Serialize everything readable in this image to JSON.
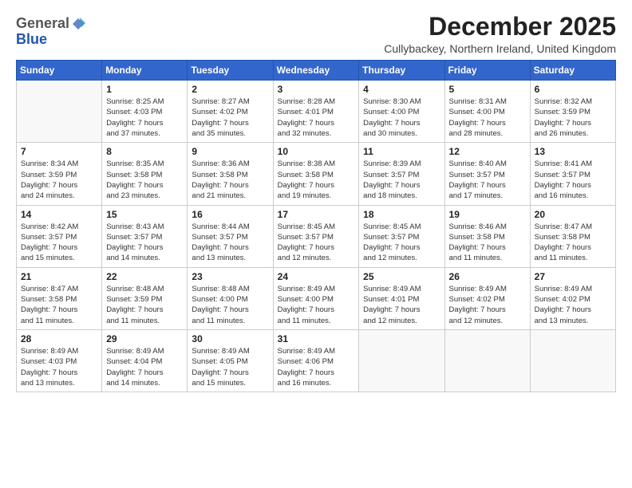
{
  "logo": {
    "general": "General",
    "blue": "Blue"
  },
  "title": "December 2025",
  "location": "Cullybackey, Northern Ireland, United Kingdom",
  "weekdays": [
    "Sunday",
    "Monday",
    "Tuesday",
    "Wednesday",
    "Thursday",
    "Friday",
    "Saturday"
  ],
  "weeks": [
    [
      {
        "day": "",
        "info": ""
      },
      {
        "day": "1",
        "info": "Sunrise: 8:25 AM\nSunset: 4:03 PM\nDaylight: 7 hours\nand 37 minutes."
      },
      {
        "day": "2",
        "info": "Sunrise: 8:27 AM\nSunset: 4:02 PM\nDaylight: 7 hours\nand 35 minutes."
      },
      {
        "day": "3",
        "info": "Sunrise: 8:28 AM\nSunset: 4:01 PM\nDaylight: 7 hours\nand 32 minutes."
      },
      {
        "day": "4",
        "info": "Sunrise: 8:30 AM\nSunset: 4:00 PM\nDaylight: 7 hours\nand 30 minutes."
      },
      {
        "day": "5",
        "info": "Sunrise: 8:31 AM\nSunset: 4:00 PM\nDaylight: 7 hours\nand 28 minutes."
      },
      {
        "day": "6",
        "info": "Sunrise: 8:32 AM\nSunset: 3:59 PM\nDaylight: 7 hours\nand 26 minutes."
      }
    ],
    [
      {
        "day": "7",
        "info": "Sunrise: 8:34 AM\nSunset: 3:59 PM\nDaylight: 7 hours\nand 24 minutes."
      },
      {
        "day": "8",
        "info": "Sunrise: 8:35 AM\nSunset: 3:58 PM\nDaylight: 7 hours\nand 23 minutes."
      },
      {
        "day": "9",
        "info": "Sunrise: 8:36 AM\nSunset: 3:58 PM\nDaylight: 7 hours\nand 21 minutes."
      },
      {
        "day": "10",
        "info": "Sunrise: 8:38 AM\nSunset: 3:58 PM\nDaylight: 7 hours\nand 19 minutes."
      },
      {
        "day": "11",
        "info": "Sunrise: 8:39 AM\nSunset: 3:57 PM\nDaylight: 7 hours\nand 18 minutes."
      },
      {
        "day": "12",
        "info": "Sunrise: 8:40 AM\nSunset: 3:57 PM\nDaylight: 7 hours\nand 17 minutes."
      },
      {
        "day": "13",
        "info": "Sunrise: 8:41 AM\nSunset: 3:57 PM\nDaylight: 7 hours\nand 16 minutes."
      }
    ],
    [
      {
        "day": "14",
        "info": "Sunrise: 8:42 AM\nSunset: 3:57 PM\nDaylight: 7 hours\nand 15 minutes."
      },
      {
        "day": "15",
        "info": "Sunrise: 8:43 AM\nSunset: 3:57 PM\nDaylight: 7 hours\nand 14 minutes."
      },
      {
        "day": "16",
        "info": "Sunrise: 8:44 AM\nSunset: 3:57 PM\nDaylight: 7 hours\nand 13 minutes."
      },
      {
        "day": "17",
        "info": "Sunrise: 8:45 AM\nSunset: 3:57 PM\nDaylight: 7 hours\nand 12 minutes."
      },
      {
        "day": "18",
        "info": "Sunrise: 8:45 AM\nSunset: 3:57 PM\nDaylight: 7 hours\nand 12 minutes."
      },
      {
        "day": "19",
        "info": "Sunrise: 8:46 AM\nSunset: 3:58 PM\nDaylight: 7 hours\nand 11 minutes."
      },
      {
        "day": "20",
        "info": "Sunrise: 8:47 AM\nSunset: 3:58 PM\nDaylight: 7 hours\nand 11 minutes."
      }
    ],
    [
      {
        "day": "21",
        "info": "Sunrise: 8:47 AM\nSunset: 3:58 PM\nDaylight: 7 hours\nand 11 minutes."
      },
      {
        "day": "22",
        "info": "Sunrise: 8:48 AM\nSunset: 3:59 PM\nDaylight: 7 hours\nand 11 minutes."
      },
      {
        "day": "23",
        "info": "Sunrise: 8:48 AM\nSunset: 4:00 PM\nDaylight: 7 hours\nand 11 minutes."
      },
      {
        "day": "24",
        "info": "Sunrise: 8:49 AM\nSunset: 4:00 PM\nDaylight: 7 hours\nand 11 minutes."
      },
      {
        "day": "25",
        "info": "Sunrise: 8:49 AM\nSunset: 4:01 PM\nDaylight: 7 hours\nand 12 minutes."
      },
      {
        "day": "26",
        "info": "Sunrise: 8:49 AM\nSunset: 4:02 PM\nDaylight: 7 hours\nand 12 minutes."
      },
      {
        "day": "27",
        "info": "Sunrise: 8:49 AM\nSunset: 4:02 PM\nDaylight: 7 hours\nand 13 minutes."
      }
    ],
    [
      {
        "day": "28",
        "info": "Sunrise: 8:49 AM\nSunset: 4:03 PM\nDaylight: 7 hours\nand 13 minutes."
      },
      {
        "day": "29",
        "info": "Sunrise: 8:49 AM\nSunset: 4:04 PM\nDaylight: 7 hours\nand 14 minutes."
      },
      {
        "day": "30",
        "info": "Sunrise: 8:49 AM\nSunset: 4:05 PM\nDaylight: 7 hours\nand 15 minutes."
      },
      {
        "day": "31",
        "info": "Sunrise: 8:49 AM\nSunset: 4:06 PM\nDaylight: 7 hours\nand 16 minutes."
      },
      {
        "day": "",
        "info": ""
      },
      {
        "day": "",
        "info": ""
      },
      {
        "day": "",
        "info": ""
      }
    ]
  ]
}
